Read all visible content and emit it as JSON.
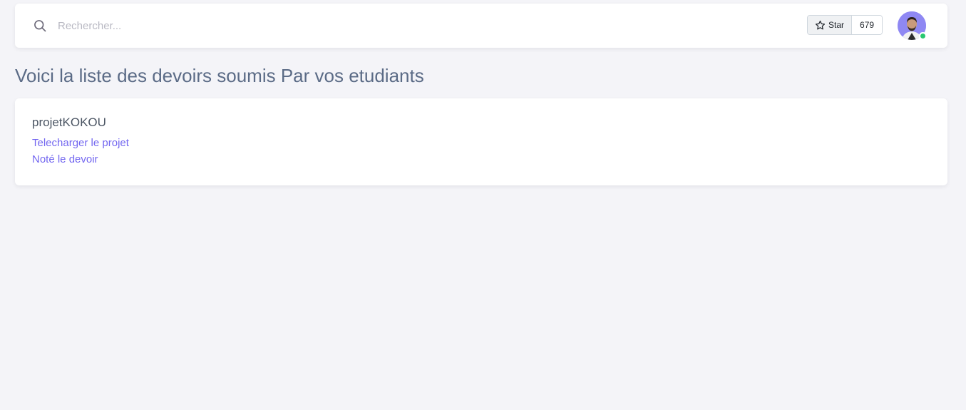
{
  "search": {
    "placeholder": "Rechercher...",
    "icon": "search-icon"
  },
  "github_star": {
    "label": "Star",
    "count": "679",
    "icon": "star-icon"
  },
  "user": {
    "status": "online",
    "status_color": "#28c76f",
    "avatar_bg": "#8f88f3"
  },
  "page": {
    "title": "Voici la liste des devoirs soumis Par vos etudiants"
  },
  "submissions": [
    {
      "name": "projetKOKOU",
      "download_label": "Telecharger le projet",
      "grade_label": "Noté le devoir"
    }
  ],
  "colors": {
    "accent": "#7367f0",
    "background": "#f4f4f8",
    "title": "#5b6b86"
  }
}
